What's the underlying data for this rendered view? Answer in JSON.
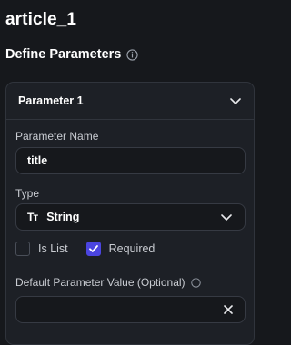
{
  "page": {
    "title": "article_1"
  },
  "section": {
    "heading": "Define Parameters",
    "info_icon": "info-icon"
  },
  "parameter": {
    "header": "Parameter 1",
    "name_label": "Parameter Name",
    "name_value": "title",
    "type_label": "Type",
    "type_icon_text": "Tт",
    "type_value": "String",
    "is_list_label": "Is List",
    "is_list_checked": false,
    "required_label": "Required",
    "required_checked": true,
    "default_label": "Default Parameter Value (Optional)",
    "default_value": ""
  },
  "colors": {
    "accent": "#4b45e0",
    "background": "#16181c",
    "panel": "#1d2026"
  }
}
